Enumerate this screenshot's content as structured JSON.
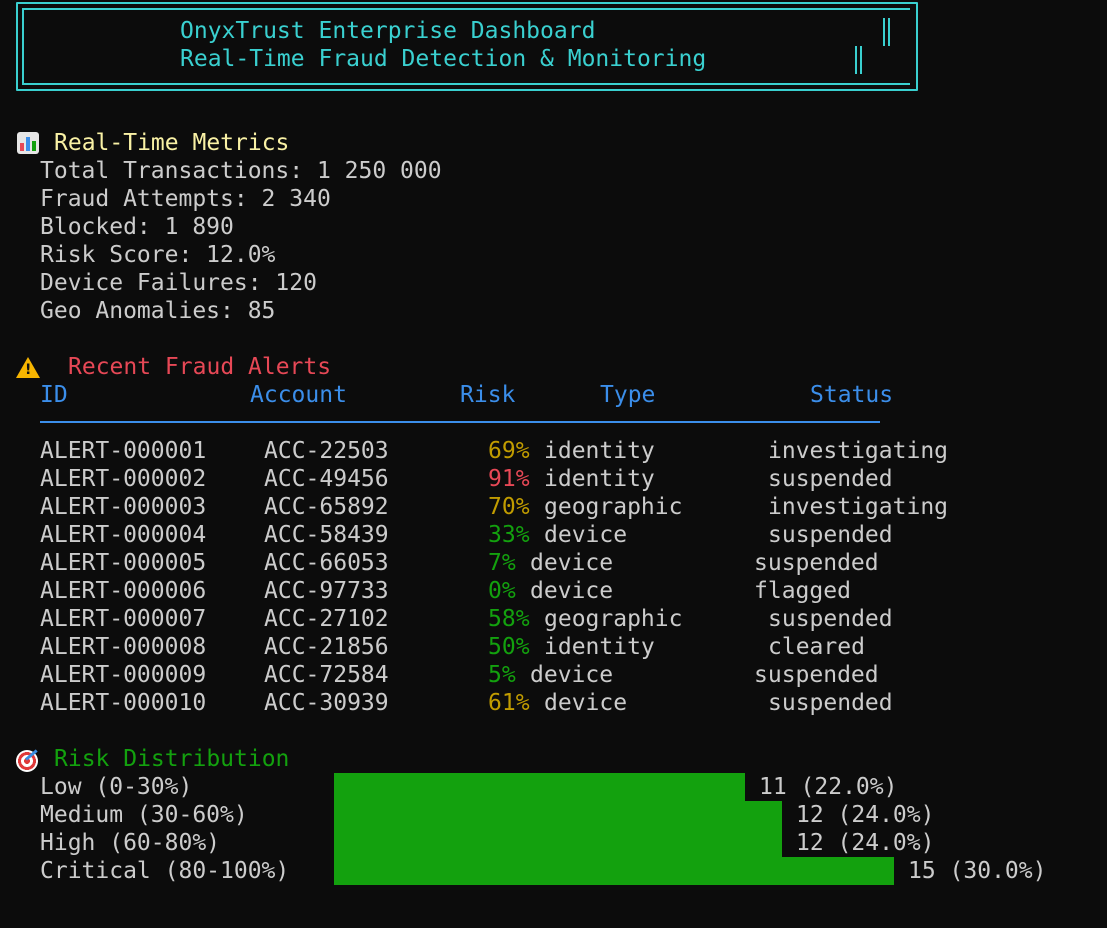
{
  "header": {
    "title": "OnyxTrust Enterprise Dashboard",
    "subtitle": "Real-Time Fraud Detection & Monitoring"
  },
  "metrics": {
    "heading": "Real-Time Metrics",
    "icon": "bar-chart-icon",
    "items": [
      {
        "text": "Total Transactions: 1 250 000"
      },
      {
        "text": "Fraud Attempts: 2 340"
      },
      {
        "text": "Blocked: 1 890"
      },
      {
        "text": "Risk Score: 12.0%"
      },
      {
        "text": "Device Failures: 120"
      },
      {
        "text": "Geo Anomalies: 85"
      }
    ]
  },
  "alerts": {
    "heading": "Recent Fraud Alerts",
    "icon": "warning-icon",
    "columns": {
      "id": "ID",
      "account": "Account",
      "risk": "Risk",
      "type": "Type",
      "status": "Status"
    },
    "rows": [
      {
        "id": "ALERT-000001",
        "account": "ACC-22503",
        "risk": "69%",
        "risk_level": "med",
        "type": "identity",
        "status": "investigating",
        "type_offset": 1
      },
      {
        "id": "ALERT-000002",
        "account": "ACC-49456",
        "risk": "91%",
        "risk_level": "high",
        "type": "identity",
        "status": "suspended",
        "type_offset": 1
      },
      {
        "id": "ALERT-000003",
        "account": "ACC-65892",
        "risk": "70%",
        "risk_level": "med",
        "type": "geographic",
        "status": "investigating",
        "type_offset": 1
      },
      {
        "id": "ALERT-000004",
        "account": "ACC-58439",
        "risk": "33%",
        "risk_level": "low",
        "type": "device",
        "status": "suspended",
        "type_offset": 1
      },
      {
        "id": "ALERT-000005",
        "account": "ACC-66053",
        "risk": "7%",
        "risk_level": "low",
        "type": "device",
        "status": "suspended",
        "type_offset": 0
      },
      {
        "id": "ALERT-000006",
        "account": "ACC-97733",
        "risk": "0%",
        "risk_level": "low",
        "type": "device",
        "status": "flagged",
        "type_offset": 0
      },
      {
        "id": "ALERT-000007",
        "account": "ACC-27102",
        "risk": "58%",
        "risk_level": "low",
        "type": "geographic",
        "status": "suspended",
        "type_offset": 1
      },
      {
        "id": "ALERT-000008",
        "account": "ACC-21856",
        "risk": "50%",
        "risk_level": "low",
        "type": "identity",
        "status": "cleared",
        "type_offset": 1
      },
      {
        "id": "ALERT-000009",
        "account": "ACC-72584",
        "risk": "5%",
        "risk_level": "low",
        "type": "device",
        "status": "suspended",
        "type_offset": 0
      },
      {
        "id": "ALERT-000010",
        "account": "ACC-30939",
        "risk": "61%",
        "risk_level": "med",
        "type": "device",
        "status": "suspended",
        "type_offset": 1
      }
    ]
  },
  "distribution": {
    "heading": "Risk Distribution",
    "icon": "target-icon",
    "bar_color": "#13a10e",
    "rows": [
      {
        "label": "Low (0-30%)",
        "count": 11,
        "value": "11 (22.0%)"
      },
      {
        "label": "Medium (30-60%)",
        "count": 12,
        "value": "12 (24.0%)"
      },
      {
        "label": "High (60-80%)",
        "count": 12,
        "value": "12 (24.0%)"
      },
      {
        "label": "Critical (80-100%)",
        "count": 15,
        "value": "15 (30.0%)"
      }
    ]
  },
  "colors": {
    "background": "#0c0c0c",
    "text": "#cccccc",
    "header": "#3ad0d0",
    "metrics_heading": "#f9f1a5",
    "alerts_heading": "#e74856",
    "column_headers": "#3b8eea",
    "risk_low": "#13a10e",
    "risk_medium": "#c19c00",
    "risk_high": "#e74856",
    "distribution_heading": "#13a10e"
  }
}
